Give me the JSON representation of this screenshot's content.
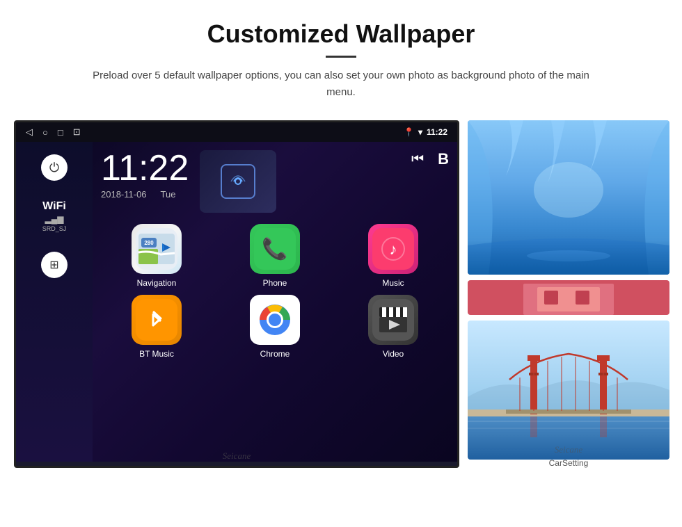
{
  "header": {
    "title": "Customized Wallpaper",
    "subtitle": "Preload over 5 default wallpaper options, you can also set your own photo as background photo of the main menu."
  },
  "device": {
    "statusBar": {
      "time": "11:22",
      "date": "2018-11-06",
      "day": "Tue"
    },
    "sidebar": {
      "wifiLabel": "WiFi",
      "wifiSSID": "SRD_SJ"
    },
    "apps": [
      {
        "name": "Navigation",
        "icon": "map"
      },
      {
        "name": "Phone",
        "icon": "phone"
      },
      {
        "name": "Music",
        "icon": "music"
      },
      {
        "name": "BT Music",
        "icon": "bluetooth"
      },
      {
        "name": "Chrome",
        "icon": "chrome"
      },
      {
        "name": "Video",
        "icon": "video"
      },
      {
        "name": "CarSetting",
        "icon": "carsetting"
      }
    ]
  },
  "watermark": "Seicane"
}
